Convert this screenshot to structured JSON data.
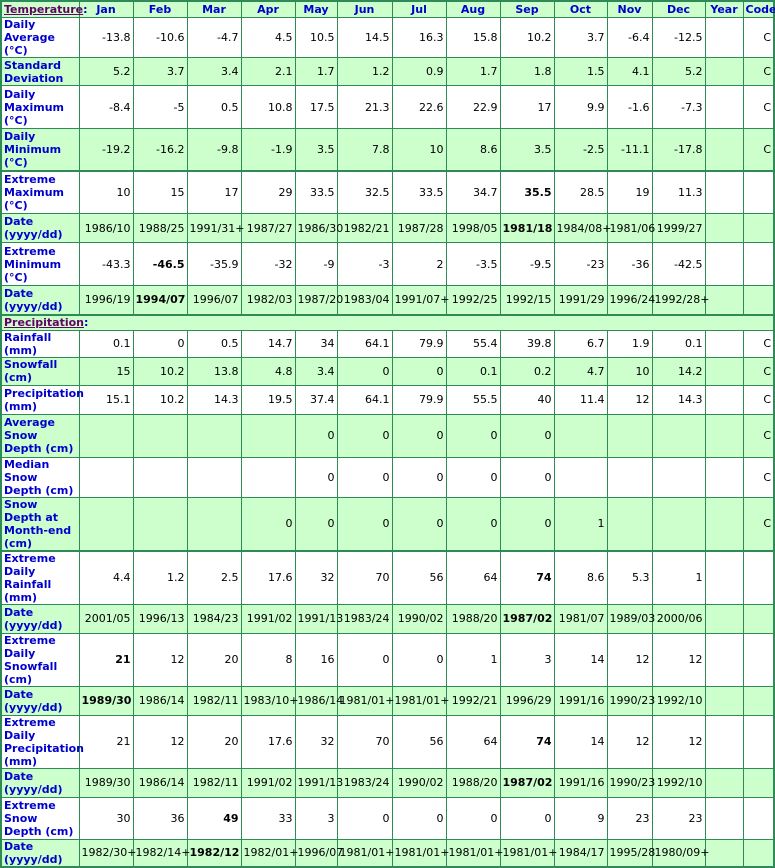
{
  "columns": [
    "Jan",
    "Feb",
    "Mar",
    "Apr",
    "May",
    "Jun",
    "Jul",
    "Aug",
    "Sep",
    "Oct",
    "Nov",
    "Dec",
    "Year",
    "Code"
  ],
  "temperature": {
    "section_label": "Temperature",
    "rows": [
      {
        "label": "Daily Average (°C)",
        "values": [
          "-13.8",
          "-10.6",
          "-4.7",
          "4.5",
          "10.5",
          "14.5",
          "16.3",
          "15.8",
          "10.2",
          "3.7",
          "-6.4",
          "-12.5",
          "",
          "C"
        ],
        "bold": []
      },
      {
        "label": "Standard Deviation",
        "values": [
          "5.2",
          "3.7",
          "3.4",
          "2.1",
          "1.7",
          "1.2",
          "0.9",
          "1.7",
          "1.8",
          "1.5",
          "4.1",
          "5.2",
          "",
          "C"
        ],
        "bold": []
      },
      {
        "label": "Daily Maximum (°C)",
        "values": [
          "-8.4",
          "-5",
          "0.5",
          "10.8",
          "17.5",
          "21.3",
          "22.6",
          "22.9",
          "17",
          "9.9",
          "-1.6",
          "-7.3",
          "",
          "C"
        ],
        "bold": []
      },
      {
        "label": "Daily Minimum (°C)",
        "values": [
          "-19.2",
          "-16.2",
          "-9.8",
          "-1.9",
          "3.5",
          "7.8",
          "10",
          "8.6",
          "3.5",
          "-2.5",
          "-11.1",
          "-17.8",
          "",
          "C"
        ],
        "bold": []
      },
      {
        "label": "Extreme Maximum (°C)",
        "values": [
          "10",
          "15",
          "17",
          "29",
          "33.5",
          "32.5",
          "33.5",
          "34.7",
          "35.5",
          "28.5",
          "19",
          "11.3",
          "",
          ""
        ],
        "bold": [
          8
        ]
      },
      {
        "label": "Date (yyyy/dd)",
        "values": [
          "1986/10",
          "1988/25",
          "1991/31+",
          "1987/27",
          "1986/30",
          "1982/21",
          "1987/28",
          "1998/05",
          "1981/18",
          "1984/08+",
          "1981/06",
          "1999/27",
          "",
          ""
        ],
        "bold": [
          8
        ]
      },
      {
        "label": "Extreme Minimum (°C)",
        "values": [
          "-43.3",
          "-46.5",
          "-35.9",
          "-32",
          "-9",
          "-3",
          "2",
          "-3.5",
          "-9.5",
          "-23",
          "-36",
          "-42.5",
          "",
          ""
        ],
        "bold": [
          1
        ]
      },
      {
        "label": "Date (yyyy/dd)",
        "values": [
          "1996/19",
          "1994/07",
          "1996/07",
          "1982/03",
          "1987/20",
          "1983/04",
          "1991/07+",
          "1992/25",
          "1992/15",
          "1991/29",
          "1996/24",
          "1992/28+",
          "",
          ""
        ],
        "bold": [
          1
        ]
      }
    ]
  },
  "precipitation": {
    "section_label": "Precipitation",
    "rows": [
      {
        "label": "Rainfall (mm)",
        "values": [
          "0.1",
          "0",
          "0.5",
          "14.7",
          "34",
          "64.1",
          "79.9",
          "55.4",
          "39.8",
          "6.7",
          "1.9",
          "0.1",
          "",
          "C"
        ],
        "bold": []
      },
      {
        "label": "Snowfall (cm)",
        "values": [
          "15",
          "10.2",
          "13.8",
          "4.8",
          "3.4",
          "0",
          "0",
          "0.1",
          "0.2",
          "4.7",
          "10",
          "14.2",
          "",
          "C"
        ],
        "bold": []
      },
      {
        "label": "Precipitation (mm)",
        "values": [
          "15.1",
          "10.2",
          "14.3",
          "19.5",
          "37.4",
          "64.1",
          "79.9",
          "55.5",
          "40",
          "11.4",
          "12",
          "14.3",
          "",
          "C"
        ],
        "bold": []
      },
      {
        "label": "Average Snow Depth (cm)",
        "values": [
          "",
          "",
          "",
          "",
          "0",
          "0",
          "0",
          "0",
          "0",
          "",
          "",
          "",
          "",
          "C"
        ],
        "bold": []
      },
      {
        "label": "Median Snow Depth (cm)",
        "values": [
          "",
          "",
          "",
          "",
          "0",
          "0",
          "0",
          "0",
          "0",
          "",
          "",
          "",
          "",
          "C"
        ],
        "bold": []
      },
      {
        "label": "Snow Depth at Month-end (cm)",
        "values": [
          "",
          "",
          "",
          "0",
          "0",
          "0",
          "0",
          "0",
          "0",
          "1",
          "",
          "",
          "",
          "C"
        ],
        "bold": []
      },
      {
        "label": "Extreme Daily Rainfall (mm)",
        "values": [
          "4.4",
          "1.2",
          "2.5",
          "17.6",
          "32",
          "70",
          "56",
          "64",
          "74",
          "8.6",
          "5.3",
          "1",
          "",
          ""
        ],
        "bold": [
          8
        ]
      },
      {
        "label": "Date (yyyy/dd)",
        "values": [
          "2001/05",
          "1996/13",
          "1984/23",
          "1991/02",
          "1991/13",
          "1983/24",
          "1990/02",
          "1988/20",
          "1987/02",
          "1981/07",
          "1989/03",
          "2000/06",
          "",
          ""
        ],
        "bold": [
          8
        ]
      },
      {
        "label": "Extreme Daily Snowfall (cm)",
        "values": [
          "21",
          "12",
          "20",
          "8",
          "16",
          "0",
          "0",
          "1",
          "3",
          "14",
          "12",
          "12",
          "",
          ""
        ],
        "bold": [
          0
        ]
      },
      {
        "label": "Date (yyyy/dd)",
        "values": [
          "1989/30",
          "1986/14",
          "1982/11",
          "1983/10+",
          "1986/14",
          "1981/01+",
          "1981/01+",
          "1992/21",
          "1996/29",
          "1991/16",
          "1990/23",
          "1992/10",
          "",
          ""
        ],
        "bold": [
          0
        ]
      },
      {
        "label": "Extreme Daily Precipitation (mm)",
        "values": [
          "21",
          "12",
          "20",
          "17.6",
          "32",
          "70",
          "56",
          "64",
          "74",
          "14",
          "12",
          "12",
          "",
          ""
        ],
        "bold": [
          8
        ]
      },
      {
        "label": "Date (yyyy/dd)",
        "values": [
          "1989/30",
          "1986/14",
          "1982/11",
          "1991/02",
          "1991/13",
          "1983/24",
          "1990/02",
          "1988/20",
          "1987/02",
          "1991/16",
          "1990/23",
          "1992/10",
          "",
          ""
        ],
        "bold": [
          8
        ]
      },
      {
        "label": "Extreme Snow Depth (cm)",
        "values": [
          "30",
          "36",
          "49",
          "33",
          "3",
          "0",
          "0",
          "0",
          "0",
          "9",
          "23",
          "23",
          "",
          ""
        ],
        "bold": [
          2
        ]
      },
      {
        "label": "Date (yyyy/dd)",
        "values": [
          "1982/30+",
          "1982/14+",
          "1982/12",
          "1982/01+",
          "1996/07",
          "1981/01+",
          "1981/01+",
          "1981/01+",
          "1981/01+",
          "1984/17",
          "1995/28",
          "1980/09+",
          "",
          ""
        ],
        "bold": [
          2
        ]
      }
    ]
  },
  "colors": {
    "row_alt": "#ccffcc",
    "row_plain": "#ffffff",
    "border": "#2e8b57",
    "label_text": "#0000cc",
    "section_link": "#660066"
  }
}
